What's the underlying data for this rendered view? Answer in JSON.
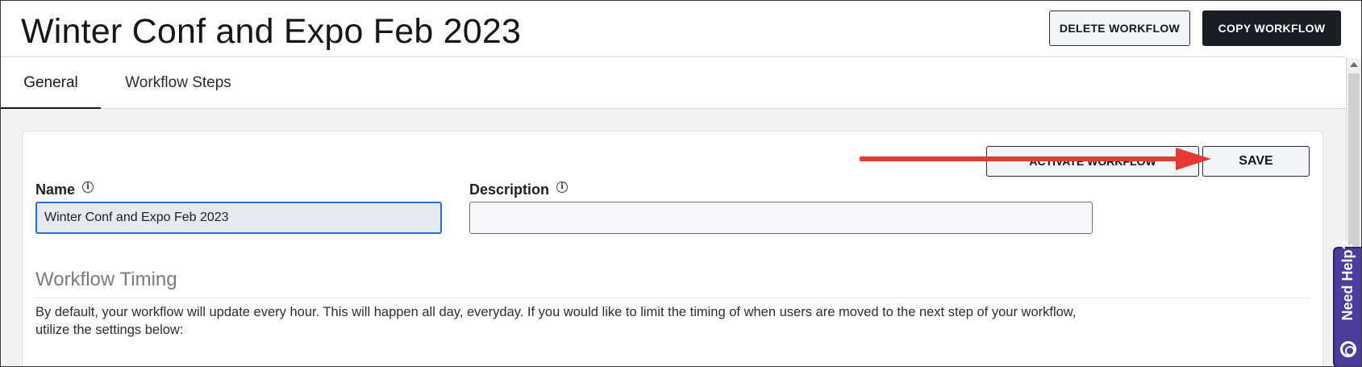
{
  "header": {
    "title": "Winter Conf and Expo Feb 2023",
    "delete_button": "DELETE WORKFLOW",
    "copy_button": "COPY WORKFLOW"
  },
  "tabs": [
    {
      "label": "General",
      "active": true
    },
    {
      "label": "Workflow Steps",
      "active": false
    }
  ],
  "actions": {
    "activate_button": "ACTIVATE WORKFLOW",
    "save_button": "SAVE"
  },
  "form": {
    "name_label": "Name",
    "name_value": "Winter Conf and Expo Feb 2023",
    "description_label": "Description",
    "description_value": "",
    "info_glyph": "i"
  },
  "timing": {
    "title": "Workflow Timing",
    "text": "By default, your workflow will update every hour. This will happen all day, everyday. If you would like to limit the timing of when users are moved to the next step of your workflow, utilize the settings below:"
  },
  "help": {
    "label": "Need Help?",
    "icon": "lifebuoy-icon"
  },
  "colors": {
    "primary_dark": "#1b1d24",
    "focus_blue": "#2a6bd6",
    "annotation_arrow": "#e53935",
    "help_purple": "#4b3d99"
  }
}
